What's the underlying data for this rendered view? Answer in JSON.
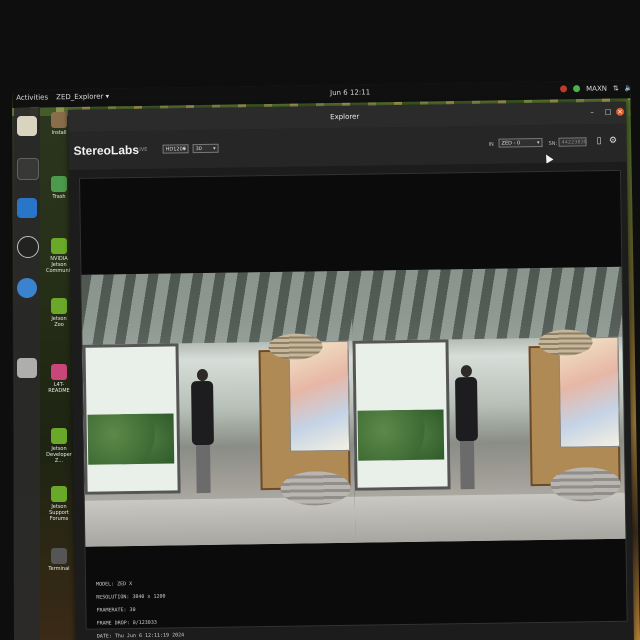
{
  "topbar": {
    "activities": "Activities",
    "app_menu": "ZED_Explorer ▾",
    "clock": "Jun 6 12:11",
    "status_user": "MAXN"
  },
  "desktop_icons": [
    {
      "label": "Install"
    },
    {
      "label": "Trash"
    },
    {
      "label": "NVIDIA Jetson Community"
    },
    {
      "label": "Jetson Zoo"
    },
    {
      "label": "L4T-README"
    },
    {
      "label": "Jetson Developer Z..."
    },
    {
      "label": "Jetson Support Forums"
    },
    {
      "label": "Terminal"
    }
  ],
  "window": {
    "title": "Explorer",
    "logo": "StereoLabs",
    "live": "LIVE",
    "resolution_select": "HD1200",
    "fps_select": "30",
    "serial_label": "SN:",
    "serial_value": "44223838",
    "device_label": "IN",
    "device_select": "ZED - 0"
  },
  "info": {
    "model": "MODEL: ZED X",
    "resolution": "RESOLUTION: 3840 x 1200",
    "framerate": "FRAMERATE: 30",
    "frame_drop": "FRAME DROP: 0/123033",
    "date": "DATE: Thu Jun 6 12:11:19 2024"
  },
  "colors": {
    "window_bg": "#1c1c1c",
    "toolbar_bg": "#262626",
    "viewer_bg": "#0b0b0b"
  }
}
